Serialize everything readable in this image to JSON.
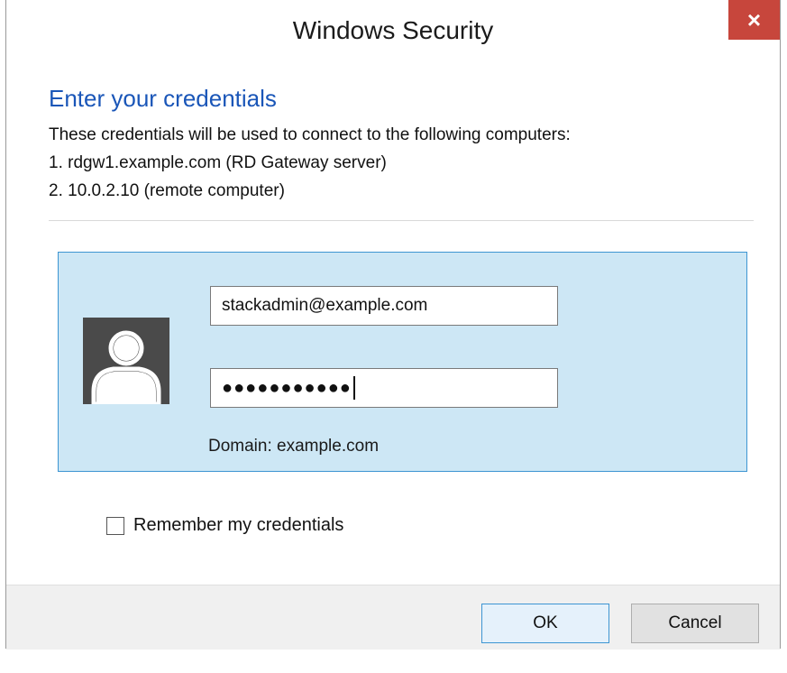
{
  "window": {
    "title": "Windows Security",
    "close_label": "×"
  },
  "content": {
    "heading": "Enter your credentials",
    "description": "These credentials will be used to connect to the following computers:",
    "computers": [
      "1. rdgw1.example.com (RD Gateway server)",
      "2. 10.0.2.10 (remote computer)"
    ]
  },
  "credentials": {
    "username_value": "stackadmin@example.com",
    "password_mask": "●●●●●●●●●●●",
    "domain_text": "Domain: example.com"
  },
  "options": {
    "remember_label": "Remember my credentials",
    "remember_checked": false
  },
  "buttons": {
    "ok_label": "OK",
    "cancel_label": "Cancel"
  },
  "colors": {
    "accent": "#1a56b8",
    "panel_bg": "#cde7f5",
    "panel_border": "#3d95d2",
    "close_bg": "#c7463c"
  }
}
